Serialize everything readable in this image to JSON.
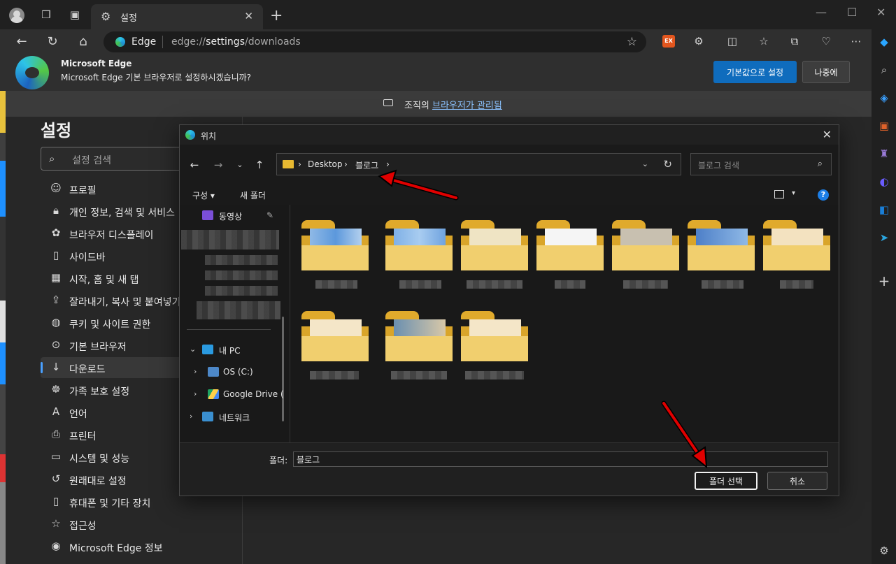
{
  "tab": {
    "title": "설정"
  },
  "address": {
    "site": "Edge",
    "url_prefix": "edge://",
    "url_bold": "settings",
    "url_suffix": "/downloads"
  },
  "infobar": {
    "name": "Microsoft Edge",
    "message": "Microsoft Edge 기본 브라우저로 설정하시겠습니까?",
    "primary_label": "기본값으로 설정",
    "secondary_label": "나중에"
  },
  "managed": {
    "prefix": "조직의 ",
    "link": "브라우저가 관리됨"
  },
  "settings": {
    "heading": "설정",
    "search_placeholder": "설정 검색",
    "items": [
      {
        "label": "프로필",
        "icon": "profile-icon"
      },
      {
        "label": "개인 정보, 검색 및 서비스",
        "icon": "lock-icon"
      },
      {
        "label": "브라우저 디스플레이",
        "icon": "palette-icon"
      },
      {
        "label": "사이드바",
        "icon": "sidebar-icon"
      },
      {
        "label": "시작, 홈 및 새 탭",
        "icon": "home-grid-icon"
      },
      {
        "label": "잘라내기, 복사 및 붙여넣기",
        "icon": "share-icon"
      },
      {
        "label": "쿠키 및 사이트 권한",
        "icon": "cookie-icon"
      },
      {
        "label": "기본 브라우저",
        "icon": "browser-icon"
      },
      {
        "label": "다운로드",
        "icon": "download-icon"
      },
      {
        "label": "가족 보호 설정",
        "icon": "family-icon"
      },
      {
        "label": "언어",
        "icon": "language-icon"
      },
      {
        "label": "프린터",
        "icon": "printer-icon"
      },
      {
        "label": "시스템 및 성능",
        "icon": "laptop-icon"
      },
      {
        "label": "원래대로 설정",
        "icon": "reset-icon"
      },
      {
        "label": "휴대폰 및 기타 장치",
        "icon": "phone-icon"
      },
      {
        "label": "접근성",
        "icon": "accessibility-icon"
      },
      {
        "label": "Microsoft Edge 정보",
        "icon": "edge-icon"
      }
    ]
  },
  "dialog": {
    "title": "위치",
    "path": [
      "Desktop",
      "블로그"
    ],
    "search_placeholder": "블로그 검색",
    "organize": "구성",
    "new_folder": "새 폴더",
    "nav": {
      "videos": "동영상",
      "this_pc": "내 PC",
      "os_drive": "OS (C:)",
      "google_drive": "Google Drive (",
      "network": "네트워크"
    },
    "folder_label": "폴더:",
    "folder_value": "블로그",
    "ok": "폴더 선택",
    "cancel": "취소"
  },
  "colors": {
    "accent": "#0f6cbd",
    "arrow": "#e00000",
    "folder": "#e8b931"
  }
}
